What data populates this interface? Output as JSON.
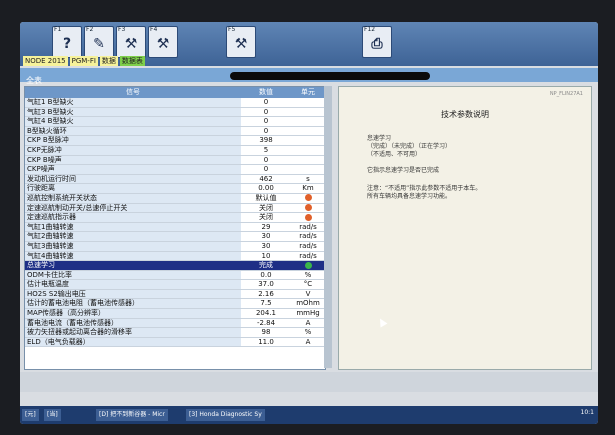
{
  "toolbar": {
    "buttons": [
      {
        "fkey": "F1",
        "icon": "help-icon",
        "glyph": "?"
      },
      {
        "fkey": "F2",
        "icon": "pen-icon",
        "glyph": "✎"
      },
      {
        "fkey": "F3",
        "icon": "tools-icon",
        "glyph": "⚒"
      },
      {
        "fkey": "F4",
        "icon": "tools-icon",
        "glyph": "⚒"
      },
      {
        "fkey": "F5",
        "icon": "tools-icon",
        "glyph": "⚒"
      },
      {
        "fkey": "F12",
        "icon": "printer-icon",
        "glyph": "⎙"
      }
    ],
    "path": [
      "NODE 2015",
      "PGM-FI",
      "数据",
      "数据表"
    ]
  },
  "title": "全表",
  "table": {
    "headers": [
      "信号",
      "数值",
      "单元"
    ],
    "rows": [
      {
        "name": "气缸1 B型缺火",
        "value": "0",
        "unit": ""
      },
      {
        "name": "气缸3 B型缺火",
        "value": "0",
        "unit": ""
      },
      {
        "name": "气缸4 B型缺火",
        "value": "0",
        "unit": ""
      },
      {
        "name": "B型缺火循环",
        "value": "0",
        "unit": ""
      },
      {
        "name": "CKP B型脉冲",
        "value": "398",
        "unit": ""
      },
      {
        "name": "CKP无脉冲",
        "value": "5",
        "unit": ""
      },
      {
        "name": "CKP B噪声",
        "value": "0",
        "unit": ""
      },
      {
        "name": "CKP噪声",
        "value": "0",
        "unit": ""
      },
      {
        "name": "发动机运行时间",
        "value": "462",
        "unit": "s"
      },
      {
        "name": "行驶距离",
        "value": "0.00",
        "unit": "Km"
      },
      {
        "name": "巡航控制系统开关状态",
        "value": "默认值",
        "unit": "dot"
      },
      {
        "name": "定速巡航制动开关/总速停止开关",
        "value": "关闭",
        "unit": "dot"
      },
      {
        "name": "定速巡航指示器",
        "value": "关闭",
        "unit": "dot"
      },
      {
        "name": "气缸1曲轴转速",
        "value": "29",
        "unit": "rad/s"
      },
      {
        "name": "气缸2曲轴转速",
        "value": "30",
        "unit": "rad/s"
      },
      {
        "name": "气缸3曲轴转速",
        "value": "30",
        "unit": "rad/s"
      },
      {
        "name": "气缸4曲轴转速",
        "value": "10",
        "unit": "rad/s"
      },
      {
        "name": "总速学习",
        "value": "完成",
        "unit": "dot-green",
        "highlight": true
      },
      {
        "name": "ODM卡住比率",
        "value": "0.0",
        "unit": "%"
      },
      {
        "name": "估计电瓶温度",
        "value": "37.0",
        "unit": "°C"
      },
      {
        "name": "HO2S S2输出电压",
        "value": "2.16",
        "unit": "V"
      },
      {
        "name": "估计的蓄电池电阻（蓄电池传感器）",
        "value": "7.5",
        "unit": "mOhm"
      },
      {
        "name": "MAP传感器（高分辨率）",
        "value": "204.1",
        "unit": "mmHg"
      },
      {
        "name": "蓄电池电流（蓄电池传感器）",
        "value": "-2.84",
        "unit": "A"
      },
      {
        "name": "被力矢扭器或起动离合器的滑移率",
        "value": "98",
        "unit": "%"
      },
      {
        "name": "ELD（电气负载器）",
        "value": "11.0",
        "unit": "A"
      }
    ]
  },
  "doc": {
    "header": "NP_FLIN27A1",
    "title": "技术参数说明",
    "lines": [
      "怠速学习",
      "（完成）（未完成）（正在学习）",
      "（不适用、不可用）",
      "",
      "它指示怠速学习是否已完成",
      "",
      "注意：“不适用”指示此参数不适用于本车。",
      "所有车辆均具备怠速学习功能。"
    ]
  },
  "taskbar": {
    "items": [
      "[元]",
      "[当]",
      "[D] 把不到新谷器 - Micr",
      "[3] Honda Diagnostic Sy"
    ],
    "clock": "10:1"
  }
}
